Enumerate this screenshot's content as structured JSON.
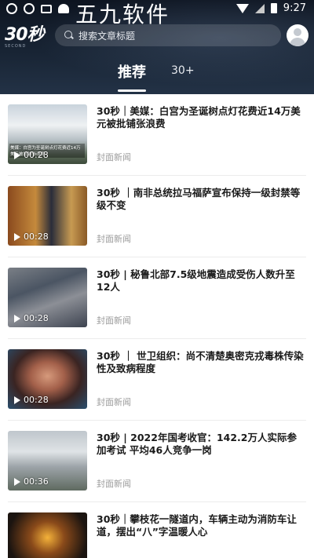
{
  "statusbar": {
    "time": "9:27",
    "watermark": "五九软件"
  },
  "header": {
    "logo_text": "30秒",
    "logo_sub": "SECOND",
    "search_placeholder": "搜索文章标题",
    "tabs": [
      {
        "label": "推荐",
        "active": true
      },
      {
        "label": "30+",
        "active": false
      }
    ]
  },
  "feed": {
    "items": [
      {
        "title": "30秒｜美媒：白宫为圣诞树点灯花费近14万美元被批铺张浪费",
        "source": "封面新闻",
        "duration": "00:28",
        "thumb_caption": "美媒：白宫为圣诞树点灯花费近14万美元被批铺张浪费"
      },
      {
        "title": "30秒 ｜南非总统拉马福萨宣布保持一级封禁等级不变",
        "source": "封面新闻",
        "duration": "00:28"
      },
      {
        "title": "30秒 | 秘鲁北部7.5级地震造成受伤人数升至12人",
        "source": "封面新闻",
        "duration": "00:28"
      },
      {
        "title": "30秒 ｜ 世卫组织：尚不清楚奥密克戎毒株传染性及致病程度",
        "source": "封面新闻",
        "duration": "00:28"
      },
      {
        "title": "30秒 | 2022年国考收官：142.2万人实际参加考试 平均46人竞争一岗",
        "source": "封面新闻",
        "duration": "00:36"
      },
      {
        "title": "30秒｜攀枝花一隧道内，车辆主动为消防车让道，摆出“八”字温暖人心",
        "source": "",
        "duration": ""
      }
    ]
  },
  "colors": {
    "header_bg": "#182434",
    "title": "#1a1a1a",
    "source": "#9b9b9b"
  }
}
